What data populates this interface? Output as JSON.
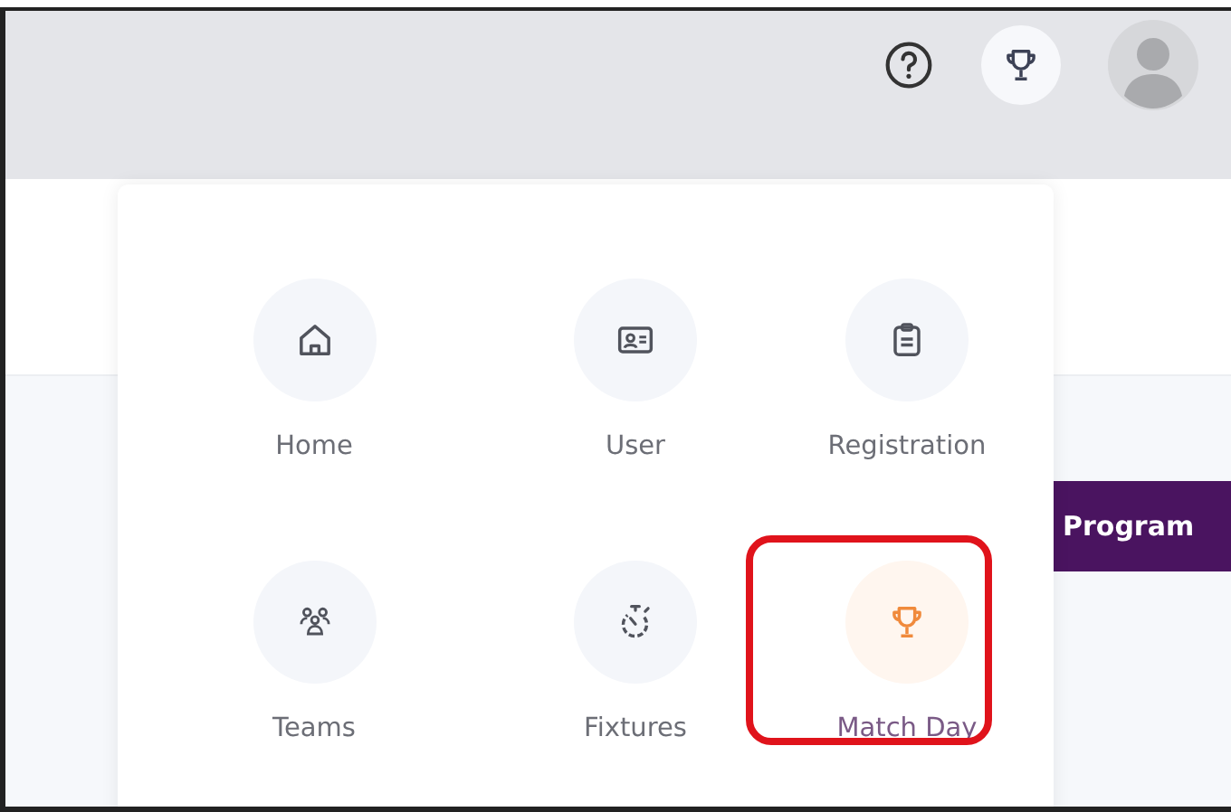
{
  "header": {
    "trophy_active": true
  },
  "program_button": {
    "label": "Program"
  },
  "menu": {
    "items": [
      {
        "label": "Home",
        "kind": "home",
        "selected": false,
        "highlighted": false
      },
      {
        "label": "User",
        "kind": "user",
        "selected": false,
        "highlighted": false
      },
      {
        "label": "Registration",
        "kind": "registration",
        "selected": false,
        "highlighted": false
      },
      {
        "label": "Teams",
        "kind": "teams",
        "selected": false,
        "highlighted": false
      },
      {
        "label": "Fixtures",
        "kind": "fixtures",
        "selected": false,
        "highlighted": false
      },
      {
        "label": "Match Day",
        "kind": "trophy",
        "selected": true,
        "highlighted": true
      }
    ]
  }
}
